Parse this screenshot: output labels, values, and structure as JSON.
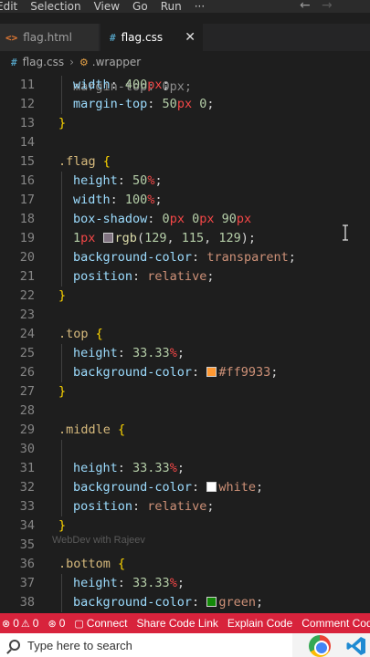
{
  "menu": [
    "Edit",
    "Selection",
    "View",
    "Go",
    "Run",
    "···"
  ],
  "tabs": [
    {
      "icon": "<>",
      "label": "flag.html"
    },
    {
      "icon": "#",
      "label": "flag.css",
      "close": "✕"
    }
  ],
  "breadcrumb": {
    "file": "flag.css",
    "selector": ".wrapper"
  },
  "code": {
    "partial_line": "margin-top: 0px;",
    "lines": [
      {
        "n": "11",
        "t": [
          [
            "prop",
            "width"
          ],
          [
            "p",
            ": "
          ],
          [
            "num",
            "400"
          ],
          [
            "unit",
            "px"
          ],
          [
            "p",
            ";"
          ]
        ],
        "indent": true
      },
      {
        "n": "12",
        "t": [
          [
            "prop",
            "margin-top"
          ],
          [
            "p",
            ": "
          ],
          [
            "num",
            "50"
          ],
          [
            "unit",
            "px"
          ],
          [
            "p",
            " "
          ],
          [
            "num",
            "0"
          ],
          [
            "p",
            ";"
          ]
        ],
        "indent": true
      },
      {
        "n": "13",
        "t": [
          [
            "brace",
            "}"
          ]
        ]
      },
      {
        "n": "14",
        "t": []
      },
      {
        "n": "15",
        "t": [
          [
            "sel",
            ".flag"
          ],
          [
            "p",
            " "
          ],
          [
            "brace",
            "{"
          ]
        ]
      },
      {
        "n": "16",
        "t": [
          [
            "prop",
            "height"
          ],
          [
            "p",
            ": "
          ],
          [
            "num",
            "50"
          ],
          [
            "unit",
            "%"
          ],
          [
            "p",
            ";"
          ]
        ],
        "indent": true
      },
      {
        "n": "17",
        "t": [
          [
            "prop",
            "width"
          ],
          [
            "p",
            ": "
          ],
          [
            "num",
            "100"
          ],
          [
            "unit",
            "%"
          ],
          [
            "p",
            ";"
          ]
        ],
        "indent": true
      },
      {
        "n": "18",
        "t": [
          [
            "prop",
            "box-shadow"
          ],
          [
            "p",
            ": "
          ],
          [
            "num",
            "0"
          ],
          [
            "unit",
            "px"
          ],
          [
            "p",
            " "
          ],
          [
            "num",
            "0"
          ],
          [
            "unit",
            "px"
          ],
          [
            "p",
            " "
          ],
          [
            "num",
            "90"
          ],
          [
            "unit",
            "px"
          ]
        ],
        "indent": true
      },
      {
        "n": "19",
        "t": [
          [
            "num",
            "1"
          ],
          [
            "unit",
            "px"
          ],
          [
            "p",
            " "
          ],
          [
            "swatch",
            "#817381"
          ],
          [
            "fn",
            "rgb"
          ],
          [
            "p",
            "("
          ],
          [
            "num",
            "129"
          ],
          [
            "p",
            ", "
          ],
          [
            "num",
            "115"
          ],
          [
            "p",
            ", "
          ],
          [
            "num",
            "129"
          ],
          [
            "p",
            ");"
          ]
        ],
        "indent": true
      },
      {
        "n": "20",
        "t": [
          [
            "prop",
            "background-color"
          ],
          [
            "p",
            ": "
          ],
          [
            "val",
            "transparent"
          ],
          [
            "p",
            ";"
          ]
        ],
        "indent": true
      },
      {
        "n": "21",
        "t": [
          [
            "prop",
            "position"
          ],
          [
            "p",
            ": "
          ],
          [
            "val",
            "relative"
          ],
          [
            "p",
            ";"
          ]
        ],
        "indent": true
      },
      {
        "n": "22",
        "t": [
          [
            "brace",
            "}"
          ]
        ]
      },
      {
        "n": "23",
        "t": []
      },
      {
        "n": "24",
        "t": [
          [
            "sel",
            ".top"
          ],
          [
            "p",
            " "
          ],
          [
            "brace",
            "{"
          ]
        ]
      },
      {
        "n": "25",
        "t": [
          [
            "prop",
            "height"
          ],
          [
            "p",
            ": "
          ],
          [
            "num",
            "33.33"
          ],
          [
            "unit",
            "%"
          ],
          [
            "p",
            ";"
          ]
        ],
        "indent": true
      },
      {
        "n": "26",
        "t": [
          [
            "prop",
            "background-color"
          ],
          [
            "p",
            ": "
          ],
          [
            "swatch",
            "#ff9933"
          ],
          [
            "val",
            "#ff9933"
          ],
          [
            "p",
            ";"
          ]
        ],
        "indent": true
      },
      {
        "n": "27",
        "t": [
          [
            "brace",
            "}"
          ]
        ]
      },
      {
        "n": "28",
        "t": []
      },
      {
        "n": "29",
        "t": [
          [
            "sel",
            ".middle"
          ],
          [
            "p",
            " "
          ],
          [
            "brace",
            "{"
          ]
        ]
      },
      {
        "n": "30",
        "t": []
      },
      {
        "n": "31",
        "t": [
          [
            "prop",
            "height"
          ],
          [
            "p",
            ": "
          ],
          [
            "num",
            "33.33"
          ],
          [
            "unit",
            "%"
          ],
          [
            "p",
            ";"
          ]
        ],
        "indent": true
      },
      {
        "n": "32",
        "t": [
          [
            "prop",
            "background-color"
          ],
          [
            "p",
            ": "
          ],
          [
            "swatch",
            "#ffffff"
          ],
          [
            "val",
            "white"
          ],
          [
            "p",
            ";"
          ]
        ],
        "indent": true
      },
      {
        "n": "33",
        "t": [
          [
            "prop",
            "position"
          ],
          [
            "p",
            ": "
          ],
          [
            "val",
            "relative"
          ],
          [
            "p",
            ";"
          ]
        ],
        "indent": true
      },
      {
        "n": "34",
        "t": [
          [
            "brace",
            "}"
          ]
        ]
      },
      {
        "n": "35",
        "t": []
      },
      {
        "n": "36",
        "t": [
          [
            "sel",
            ".bottom"
          ],
          [
            "p",
            " "
          ],
          [
            "brace",
            "{"
          ]
        ]
      },
      {
        "n": "37",
        "t": [
          [
            "prop",
            "height"
          ],
          [
            "p",
            ": "
          ],
          [
            "num",
            "33.33"
          ],
          [
            "unit",
            "%"
          ],
          [
            "p",
            ";"
          ]
        ],
        "indent": true
      },
      {
        "n": "38",
        "t": [
          [
            "prop",
            "background-color"
          ],
          [
            "p",
            ": "
          ],
          [
            "swatch",
            "#138808"
          ],
          [
            "val",
            "green"
          ],
          [
            "p",
            ";"
          ]
        ],
        "indent": true
      }
    ]
  },
  "watermark": "WebDev with Rajeev",
  "status": {
    "errors": "0",
    "warnings": "0",
    "ports": "0",
    "items": [
      "Connect",
      "Share Code Link",
      "Explain Code",
      "Comment Code"
    ]
  },
  "taskbar": {
    "search_placeholder": "Type here to search"
  },
  "colors": {
    "status_bar": "#d8233c",
    "editor_bg": "#1e1e1e"
  }
}
